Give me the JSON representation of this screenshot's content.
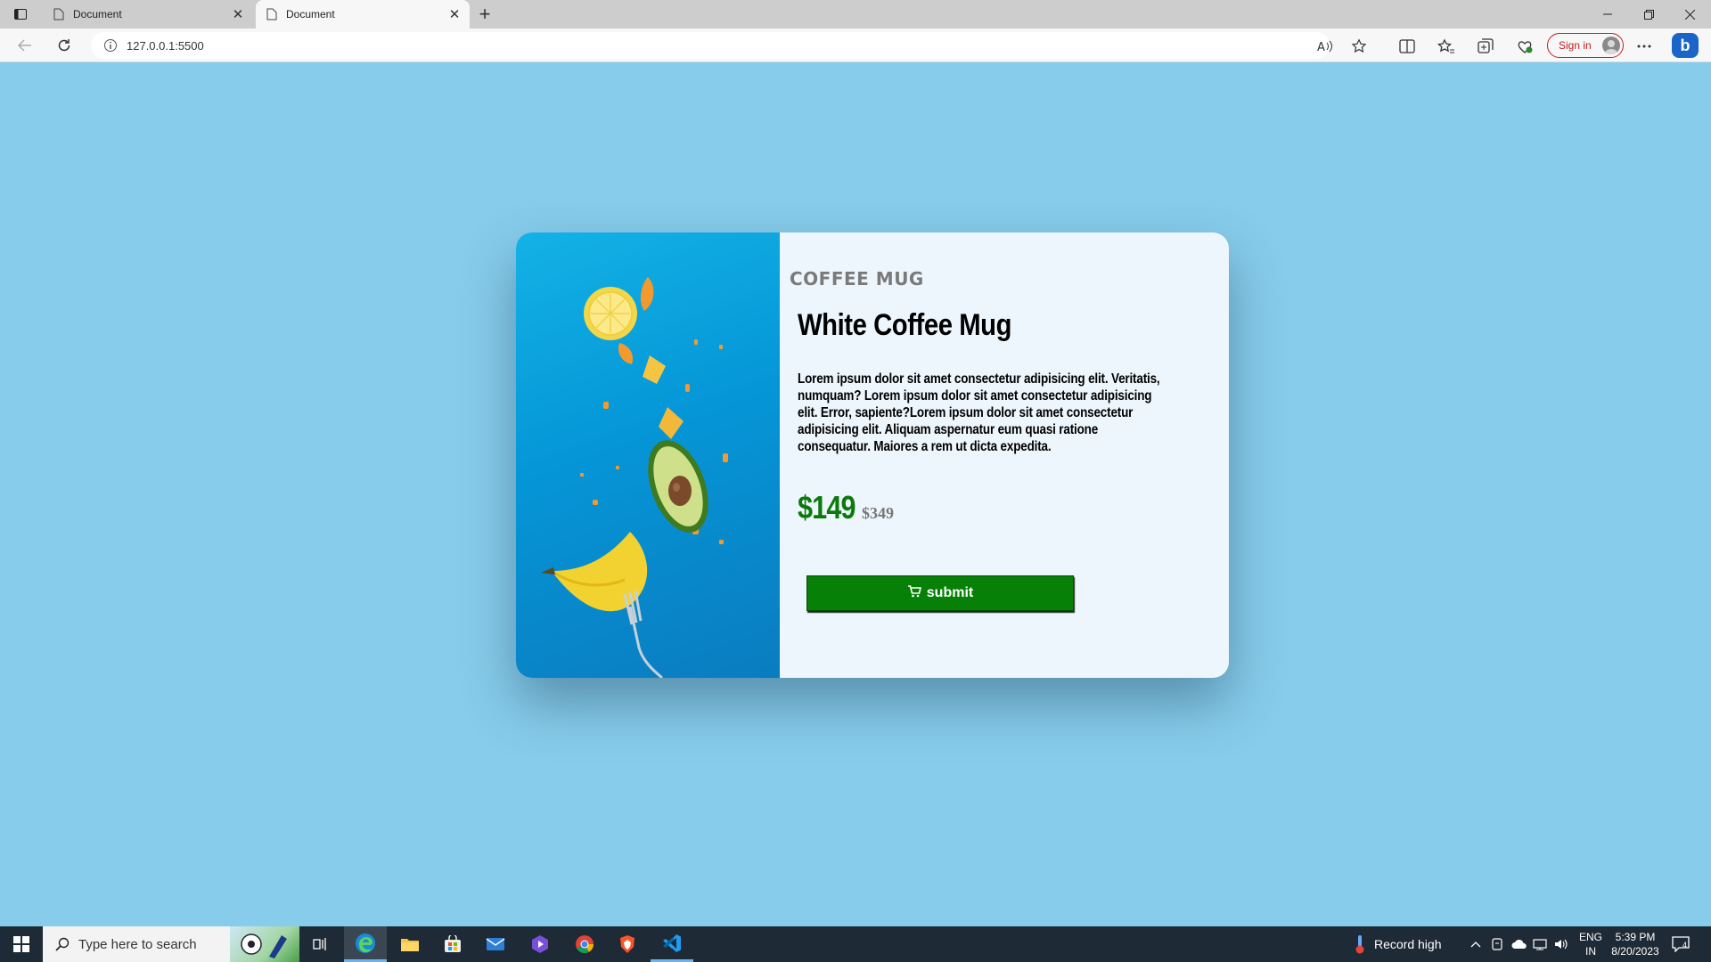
{
  "browser": {
    "tabs": [
      {
        "title": "Document",
        "active": false
      },
      {
        "title": "Document",
        "active": true
      }
    ],
    "url": "127.0.0.1:5500",
    "signin_label": "Sign in",
    "copilot_label": "b"
  },
  "product": {
    "category": "COFFEE MUG",
    "title": "White Coffee Mug",
    "description": "Lorem ipsum dolor sit amet consectetur adipisicing elit. Veritatis, numquam? Lorem ipsum dolor sit amet consectetur adipisicing elit. Error, sapiente?Lorem ipsum dolor sit amet consectetur adipisicing elit. Aliquam aspernatur eum quasi ratione consequatur. Maiores a rem ut dicta expedita.",
    "price": "$149",
    "old_price": "$349",
    "button_label": "submit",
    "button_icon": "cart-icon",
    "colors": {
      "price": "#0b7a0b",
      "button": "#078007",
      "background": "#87cceb",
      "card": "#eef6fd"
    }
  },
  "taskbar": {
    "search_placeholder": "Type here to search",
    "weather": "Record high",
    "lang_line1": "ENG",
    "lang_line2": "IN",
    "time": "5:39 PM",
    "date": "8/20/2023",
    "notification_count": "4"
  }
}
